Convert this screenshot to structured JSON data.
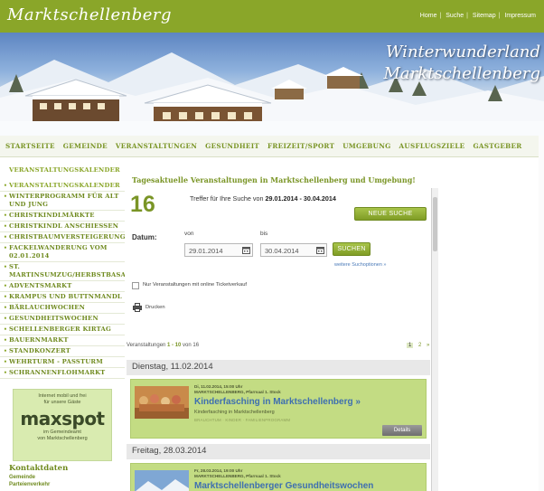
{
  "site": {
    "logo_text": "Marktschellenberg",
    "top_links": [
      "Home",
      "Suche",
      "Sitemap",
      "Impressum"
    ],
    "banner_title_line1": "Winterwunderland",
    "banner_title_line2": "Marktschellenberg"
  },
  "main_nav": {
    "items": [
      "STARTSEITE",
      "GEMEINDE",
      "VERANSTALTUNGEN",
      "GESUNDHEIT",
      "FREIZEIT/SPORT",
      "UMGEBUNG",
      "AUSFLUGSZIELE",
      "GASTGEBER"
    ]
  },
  "sidebar": {
    "heading": "VERANSTALTUNGSKALENDER",
    "items": [
      "VERANSTALTUNGSKALENDER",
      "WINTERPROGRAMM FÜR ALT UND JUNG",
      "CHRISTKINDLMÄRKTE",
      "CHRISTKINDL ANSCHIESSEN",
      "CHRISTBAUMVERSTEIGERUNG",
      "FACKELWANDERUNG VOM 02.01.2014",
      "ST. MARTINSUMZUG/HERBSTBASAR",
      "ADVENTSMARKT",
      "KRAMPUS UND BUTTNMANDL",
      "BÄRLAUCHWOCHEN",
      "GESUNDHEITSWOCHEN",
      "SCHELLENBERGER KIRTAG",
      "BAUERNMARKT",
      "STANDKONZERT",
      "WEHRTURM - PASSTURM",
      "SCHRANNENFLOHMARKT"
    ],
    "maxspot": {
      "top_line1": "Internet mobil und frei",
      "top_line2": "für unsere Gäste",
      "logo": "maxspot",
      "bottom_line1": "im Gemeindeamt",
      "bottom_line2": "von Marktschellenberg"
    },
    "contact": {
      "title": "Kontaktdaten",
      "links": [
        "Gemeinde",
        "Parteienverkehr"
      ]
    }
  },
  "content": {
    "title": "Tagesaktuelle Veranstaltungen in Marktschellenberg und Umgebung!",
    "result_count": "16",
    "result_prefix": "Treffer für Ihre Suche von ",
    "result_range": "29.01.2014 - 30.04.2014",
    "new_search_label": "NEUE SUCHE",
    "date_label": "Datum:",
    "from_label": "von",
    "to_label": "bis",
    "from_value": "29.01.2014",
    "to_value": "30.04.2014",
    "search_label": "SUCHEN",
    "more_options": "weitere Suchoptionen »",
    "ticket_checkbox_label": "Nur Veranstaltungen mit online Ticketverkauf",
    "print_label": "Drucken",
    "range_prefix": "Veranstaltungen ",
    "range_value": "1 - 10",
    "range_suffix": " von 16",
    "pages": [
      "1",
      "2",
      "»"
    ],
    "days": [
      {
        "header": "Dienstag, 11.02.2014",
        "event": {
          "meta_line1": "Di, 11.02.2014, 15:00 Uhr",
          "meta_line2": "MARKTSCHELLENBERG, Pfarrsaal 1. Stock",
          "title": "Kinderfasching in Marktschellenberg »",
          "subtitle": "Kinderfasching in Marktschellenberg",
          "tags": "BRAUCHTUM · KINDER · FAMILIENPROGRAMM",
          "details_label": "Details"
        }
      },
      {
        "header": "Freitag, 28.03.2014",
        "event": {
          "meta_line1": "Fr, 28.03.2014, 19:00 Uhr",
          "meta_line2": "MARKTSCHELLENBERG, Pfarrsaal 1. Stock",
          "title": "Marktschellenberger Gesundheitswochen",
          "subtitle": "",
          "tags": "",
          "details_label": ""
        }
      }
    ]
  }
}
